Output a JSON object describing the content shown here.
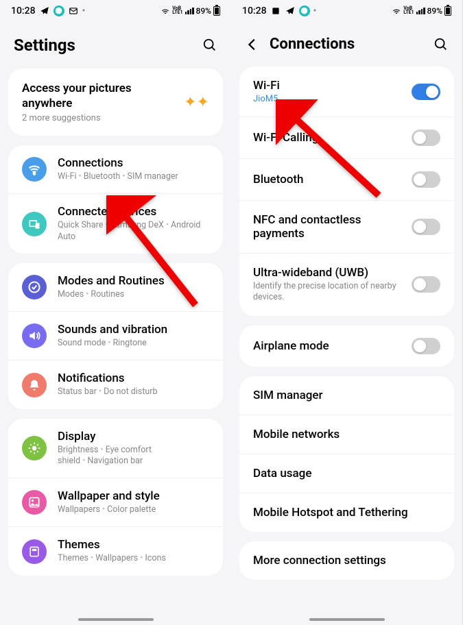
{
  "status": {
    "time": "10:28",
    "battery_pct": "89%"
  },
  "left": {
    "title": "Settings",
    "suggestion": {
      "title": "Access your pictures anywhere",
      "sub": "2 more suggestions"
    },
    "groups": [
      {
        "items": [
          {
            "title": "Connections",
            "desc": "Wi-Fi • Bluetooth • SIM manager",
            "color": "#4a9de8",
            "icon": "wifi"
          },
          {
            "title": "Connected devices",
            "desc": "Quick Share • Samsung DeX • Android Auto",
            "color": "#3fc8c0",
            "icon": "devices"
          }
        ]
      },
      {
        "items": [
          {
            "title": "Modes and Routines",
            "desc": "Modes • Routines",
            "color": "#5a5fd6",
            "icon": "check"
          },
          {
            "title": "Sounds and vibration",
            "desc": "Sound mode • Ringtone",
            "color": "#7a6cf0",
            "icon": "sound"
          },
          {
            "title": "Notifications",
            "desc": "Status bar • Do not disturb",
            "color": "#f07a6c",
            "icon": "bell"
          }
        ]
      },
      {
        "items": [
          {
            "title": "Display",
            "desc": "Brightness • Eye comfort shield • Navigation bar",
            "color": "#7fc241",
            "icon": "display"
          },
          {
            "title": "Wallpaper and style",
            "desc": "Wallpapers • Color palette",
            "color": "#e85aa5",
            "icon": "wallpaper"
          },
          {
            "title": "Themes",
            "desc": "Themes • Wallpapers • Icons",
            "color": "#9a5ae8",
            "icon": "themes"
          }
        ]
      }
    ]
  },
  "right": {
    "title": "Connections",
    "groups": [
      {
        "items": [
          {
            "title": "Wi-Fi",
            "sub": "JioM5",
            "toggle": true,
            "on": true
          },
          {
            "title": "Wi-Fi Calling",
            "toggle": true,
            "on": false
          },
          {
            "title": "Bluetooth",
            "toggle": true,
            "on": false
          },
          {
            "title": "NFC and contactless payments",
            "toggle": true,
            "on": false
          },
          {
            "title": "Ultra-wideband (UWB)",
            "desc": "Identify the precise location of nearby devices.",
            "toggle": true,
            "on": false
          }
        ]
      },
      {
        "items": [
          {
            "title": "Airplane mode",
            "toggle": true,
            "on": false
          }
        ]
      },
      {
        "items": [
          {
            "title": "SIM manager"
          },
          {
            "title": "Mobile networks"
          },
          {
            "title": "Data usage"
          },
          {
            "title": "Mobile Hotspot and Tethering"
          }
        ]
      },
      {
        "items": [
          {
            "title": "More connection settings"
          }
        ]
      }
    ]
  }
}
